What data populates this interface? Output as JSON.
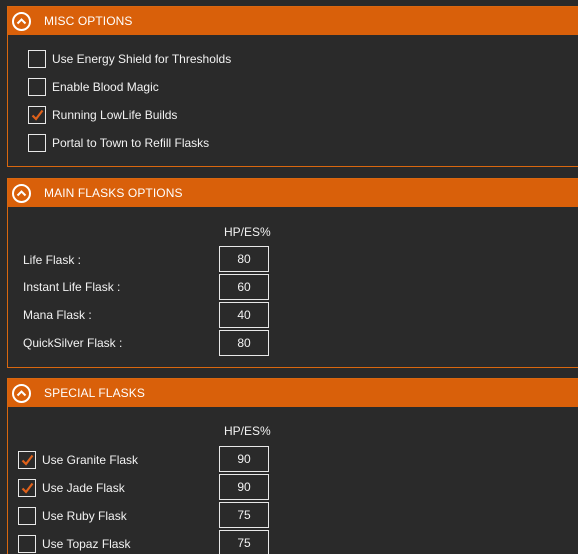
{
  "misc": {
    "title": "MISC OPTIONS",
    "options": [
      {
        "label": "Use Energy Shield for Thresholds",
        "checked": false
      },
      {
        "label": "Enable Blood Magic",
        "checked": false
      },
      {
        "label": "Running LowLife Builds",
        "checked": true
      },
      {
        "label": "Portal to Town to Refill Flasks",
        "checked": false
      }
    ]
  },
  "main_flasks": {
    "title": "MAIN FLASKS OPTIONS",
    "column_header": "HP/ES%",
    "rows": [
      {
        "label": "Life Flask :",
        "value": "80"
      },
      {
        "label": "Instant Life Flask :",
        "value": "60"
      },
      {
        "label": "Mana Flask :",
        "value": "40"
      },
      {
        "label": "QuickSilver Flask :",
        "value": "80"
      }
    ]
  },
  "special_flasks": {
    "title": "SPECIAL FLASKS",
    "column_header": "HP/ES%",
    "rows": [
      {
        "label": "Use Granite Flask",
        "checked": true,
        "value": "90"
      },
      {
        "label": "Use Jade Flask",
        "checked": true,
        "value": "90"
      },
      {
        "label": "Use Ruby Flask",
        "checked": false,
        "value": "75"
      },
      {
        "label": "Use Topaz Flask",
        "checked": false,
        "value": "75"
      }
    ]
  },
  "colors": {
    "accent": "#d9600a",
    "background": "#2a2a2a",
    "check": "#e0611a"
  },
  "icons": {
    "collapse": "chevron-up-circle-icon",
    "check": "checkmark-icon"
  }
}
